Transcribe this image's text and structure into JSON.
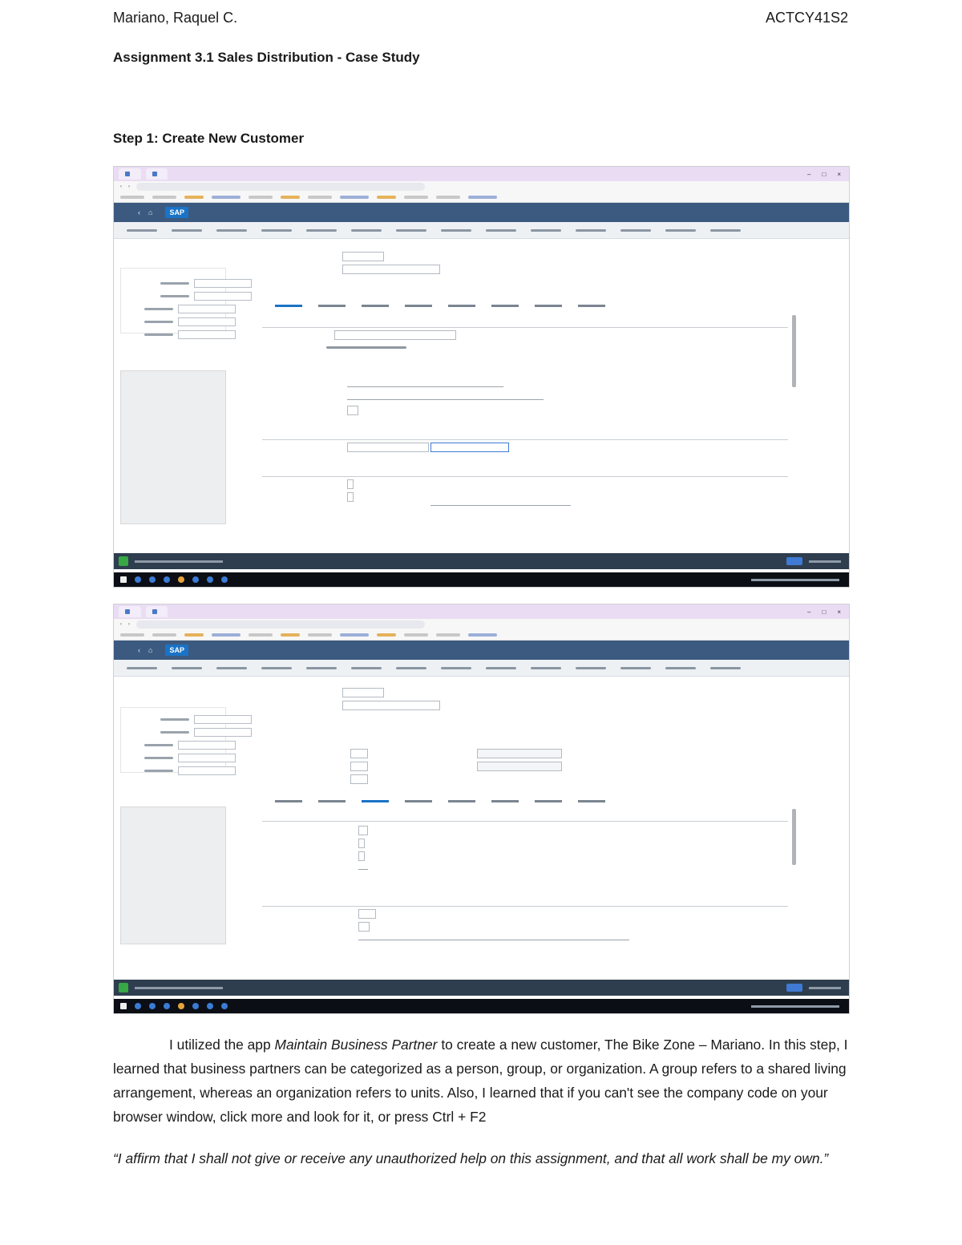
{
  "header": {
    "author": "Mariano, Raquel C.",
    "course": "ACTCY41S2"
  },
  "doc": {
    "title": "Assignment 3.1 Sales Distribution - Case Study",
    "step_title": "Step 1: Create New Customer"
  },
  "screenshots": [
    {
      "app_logo": "SAP",
      "window_controls": [
        "–",
        "□",
        "×"
      ]
    },
    {
      "app_logo": "SAP",
      "window_controls": [
        "–",
        "□",
        "×"
      ]
    }
  ],
  "body": {
    "p1_before": "I utilized the app ",
    "p1_app": "Maintain Business Partner",
    "p1_after": " to create a new customer, The Bike Zone – Mariano. In this step, I learned that business partners can be categorized as a person, group, or organization. A group refers to a shared living arrangement, whereas an organization refers to units. Also, I learned that if you can't see the company code on your browser window, click more and look for it, or press Ctrl + F2",
    "affirmation": "“I affirm that I shall not give or receive any unauthorized help on this assignment, and that all work shall be my own.”"
  }
}
